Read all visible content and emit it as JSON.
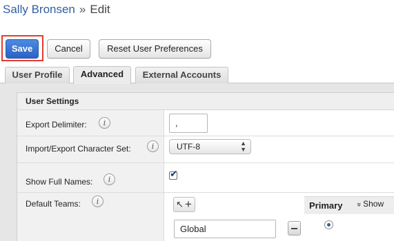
{
  "breadcrumb": {
    "user": "Sally Bronsen",
    "separator": "»",
    "current": "Edit"
  },
  "toolbar": {
    "save_label": "Save",
    "cancel_label": "Cancel",
    "reset_label": "Reset User Preferences"
  },
  "tabs": [
    {
      "label": "User Profile",
      "active": false
    },
    {
      "label": "Advanced",
      "active": true
    },
    {
      "label": "External Accounts",
      "active": false
    }
  ],
  "section": {
    "title": "User Settings"
  },
  "fields": {
    "export_delimiter": {
      "label": "Export Delimiter:",
      "value": ","
    },
    "charset": {
      "label": "Import/Export Character Set:",
      "value": "UTF-8"
    },
    "show_full_names": {
      "label": "Show Full Names:",
      "checked": true
    },
    "default_teams": {
      "label": "Default Teams:",
      "team_value": "Global",
      "primary_header": "Primary",
      "show_label": "Show"
    }
  },
  "icons": {
    "info": "i",
    "show_chevron": "»",
    "select_arrows": "▲▼",
    "check": "✔",
    "select_team": "↖",
    "add_team": "+"
  },
  "colors": {
    "accent": "#2f5fa5",
    "save_bg": "#2a62c6",
    "highlight": "#e23a2c"
  }
}
